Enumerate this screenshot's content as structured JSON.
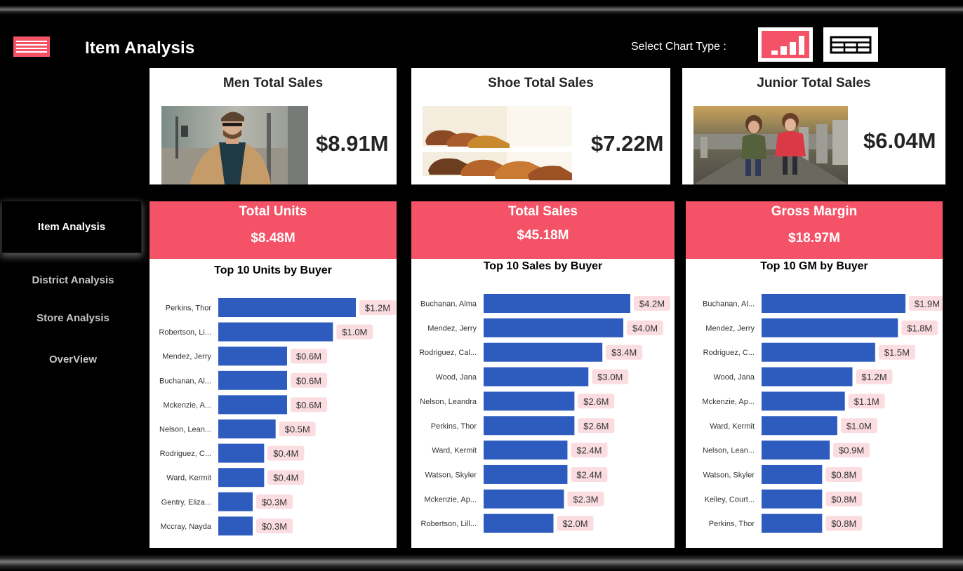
{
  "header": {
    "title": "Item Analysis",
    "chart_type_label": "Select Chart Type :"
  },
  "icons": {
    "menu": "hamburger-menu-icon",
    "bar_toggle": "bar-chart-icon",
    "table_toggle": "table-icon"
  },
  "kpi_cards": [
    {
      "title": "Men Total Sales",
      "value": "$8.91M",
      "image": "man-in-coat-photo"
    },
    {
      "title": "Shoe Total Sales",
      "value": "$7.22M",
      "image": "shoes-on-shelf-photo"
    },
    {
      "title": "Junior Total Sales",
      "value": "$6.04M",
      "image": "two-children-photo"
    }
  ],
  "nav": {
    "items": [
      "Item Analysis",
      "District Analysis",
      "Store Analysis",
      "OverView"
    ],
    "active": "Item Analysis"
  },
  "panels": [
    {
      "header": "Total Units",
      "value": "$8.48M"
    },
    {
      "header": "Total Sales",
      "value": "$45.18M"
    },
    {
      "header": "Gross Margin",
      "value": "$18.97M"
    }
  ],
  "colors": {
    "accent": "#f45266",
    "bar": "#2e5bbe",
    "label_bg": "#fbdde1",
    "background": "#000000"
  },
  "chart_data": [
    {
      "type": "bar",
      "orientation": "horizontal",
      "title": "Top 10 Units by Buyer",
      "categories": [
        "Perkins, Thor",
        "Robertson, Li...",
        "Mendez, Jerry",
        "Buchanan, Al...",
        "Mckenzie, A...",
        "Nelson, Lean...",
        "Rodriguez, C...",
        "Ward, Kermit",
        "Gentry, Eliza...",
        "Mccray, Nayda"
      ],
      "values": [
        1.2,
        1.0,
        0.6,
        0.6,
        0.6,
        0.5,
        0.4,
        0.4,
        0.3,
        0.3
      ],
      "labels": [
        "$1.2M",
        "$1.0M",
        "$0.6M",
        "$0.6M",
        "$0.6M",
        "$0.5M",
        "$0.4M",
        "$0.4M",
        "$0.3M",
        "$0.3M"
      ]
    },
    {
      "type": "bar",
      "orientation": "horizontal",
      "title": "Top 10 Sales by Buyer",
      "categories": [
        "Buchanan, Alma",
        "Mendez, Jerry",
        "Rodriguez, Cal...",
        "Wood, Jana",
        "Nelson, Leandra",
        "Perkins, Thor",
        "Ward, Kermit",
        "Watson, Skyler",
        "Mckenzie, Ap...",
        "Robertson, Lill..."
      ],
      "values": [
        4.2,
        4.0,
        3.4,
        3.0,
        2.6,
        2.6,
        2.4,
        2.4,
        2.3,
        2.0
      ],
      "labels": [
        "$4.2M",
        "$4.0M",
        "$3.4M",
        "$3.0M",
        "$2.6M",
        "$2.6M",
        "$2.4M",
        "$2.4M",
        "$2.3M",
        "$2.0M"
      ]
    },
    {
      "type": "bar",
      "orientation": "horizontal",
      "title": "Top 10 GM by Buyer",
      "categories": [
        "Buchanan, Al...",
        "Mendez, Jerry",
        "Rodriguez, C...",
        "Wood, Jana",
        "Mckenzie, Ap...",
        "Ward, Kermit",
        "Nelson, Lean...",
        "Watson, Skyler",
        "Kelley, Court...",
        "Perkins, Thor"
      ],
      "values": [
        1.9,
        1.8,
        1.5,
        1.2,
        1.1,
        1.0,
        0.9,
        0.8,
        0.8,
        0.8
      ],
      "labels": [
        "$1.9M",
        "$1.8M",
        "$1.5M",
        "$1.2M",
        "$1.1M",
        "$1.0M",
        "$0.9M",
        "$0.8M",
        "$0.8M",
        "$0.8M"
      ]
    }
  ]
}
